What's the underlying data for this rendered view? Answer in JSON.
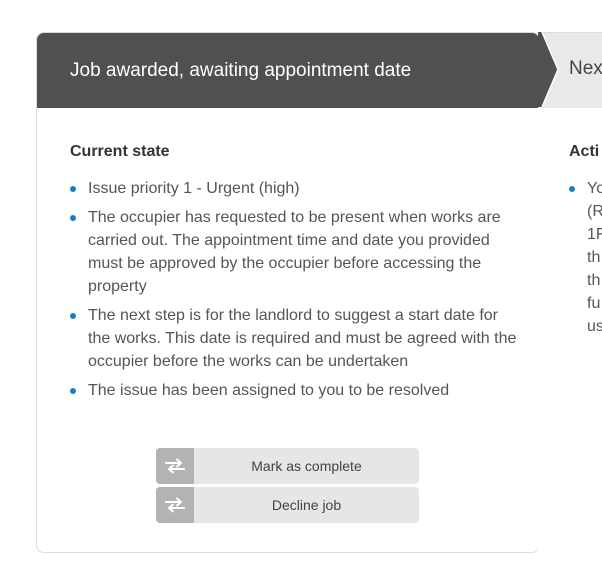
{
  "current_card": {
    "header_title": "Job awarded, awaiting appointment date",
    "section_title": "Current state",
    "bullets": [
      "Issue priority 1 - Urgent (high)",
      "The occupier has requested to be present when works are carried out. The appointment time and date you provided must be approved by the occupier before accessing the property",
      "The next step is for the landlord to suggest a start date for the works. This date is required and must be agreed with the occupier before the works can be undertaken",
      "The issue has been assigned to you to be resolved"
    ],
    "buttons": {
      "mark_complete_label": "Mark as complete",
      "decline_label": "Decline job"
    }
  },
  "next_card": {
    "header_title_visible": "Nex",
    "section_title_visible": "Acti",
    "bullet_lines_visible": [
      "Yo",
      "(R",
      "1F",
      "th",
      "th",
      "fu",
      "us"
    ]
  },
  "colors": {
    "header_bg": "#505050",
    "bullet_dot": "#1a7fc1",
    "button_bg": "#e6e6e6",
    "button_icon_bg": "#b3b3b3",
    "next_header_bg": "#e9e9e9"
  },
  "icons": {
    "button_icon": "swap-arrows-icon",
    "bullet_icon": "bullet-dot-icon",
    "step_separator": "chevron-right-icon"
  }
}
